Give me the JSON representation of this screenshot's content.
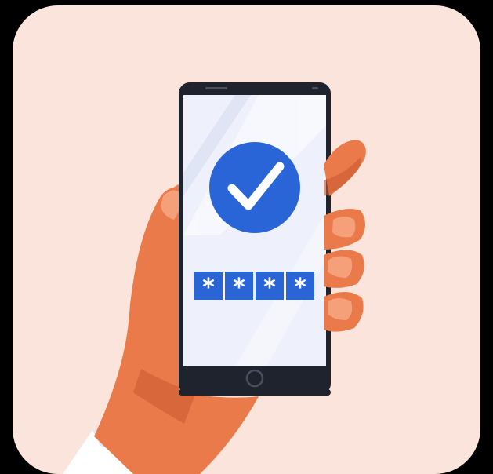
{
  "pin": {
    "digits": [
      "*",
      "*",
      "*",
      "*"
    ]
  },
  "colors": {
    "background": "#fbe4db",
    "accent_blue": "#2a65d8",
    "skin": "#ea7a4a",
    "skin_shadow": "#c95a30",
    "phone_frame": "#1f232d"
  },
  "icons": {
    "status": "check-circle-icon",
    "home_button": "home-button-icon"
  }
}
